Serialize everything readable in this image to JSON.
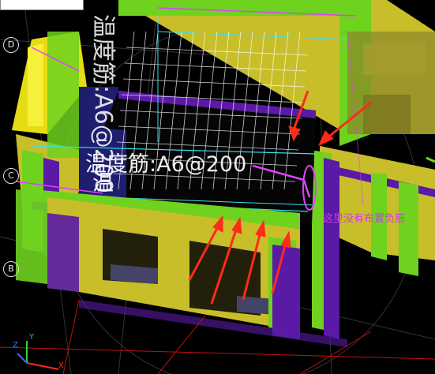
{
  "viewport": {
    "axis_tags": [
      "D",
      "C",
      "B"
    ],
    "annotation_text": "温度筋:A6@200",
    "annotation_text_second_line": "温",
    "note_label": "这里没有布置负筋",
    "ucs": {
      "z": "Z",
      "y": "Y",
      "x": "X"
    },
    "colors": {
      "wall_green": "#6fd21f",
      "wall_purple": "#5a1aa5",
      "wall_yellow": "#c8be2a",
      "grid_line": "#ffffff",
      "outline_cyan": "#38e0f0",
      "outline_magenta": "#e040ff",
      "arrow_red": "#ff2a1a",
      "hole_black": "#050505",
      "beam_navy": "#1e1e6e",
      "note_pink": "#d33be6"
    }
  }
}
